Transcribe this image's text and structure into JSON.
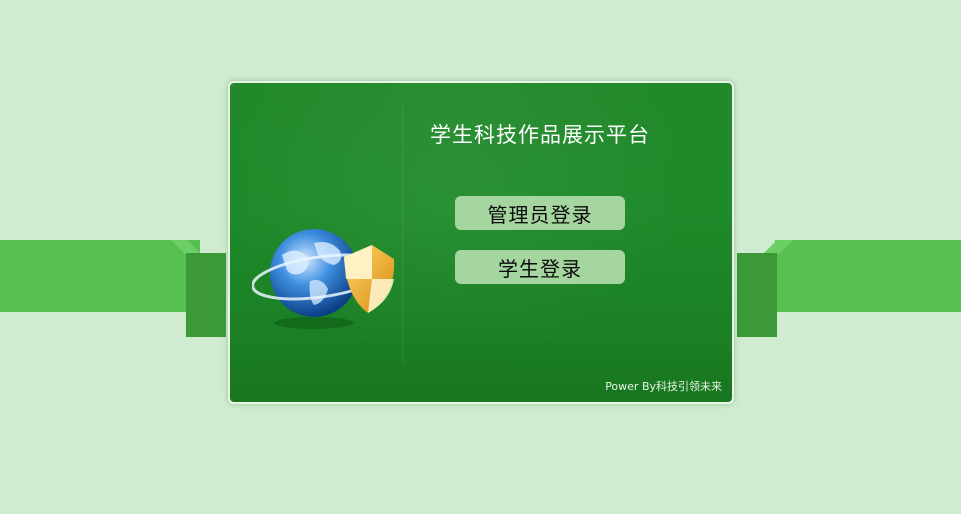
{
  "app": {
    "title": "学生科技作品展示平台"
  },
  "login": {
    "admin_label": "管理员登录",
    "student_label": "学生登录"
  },
  "footer": {
    "power_by": "Power By科技引领未来"
  },
  "colors": {
    "page_background": "#d0ecd0",
    "band": "#57c051",
    "panel": "#1e8a2a",
    "button": "#a6d6a0"
  },
  "icons": {
    "logo": "globe-with-shield-icon"
  }
}
